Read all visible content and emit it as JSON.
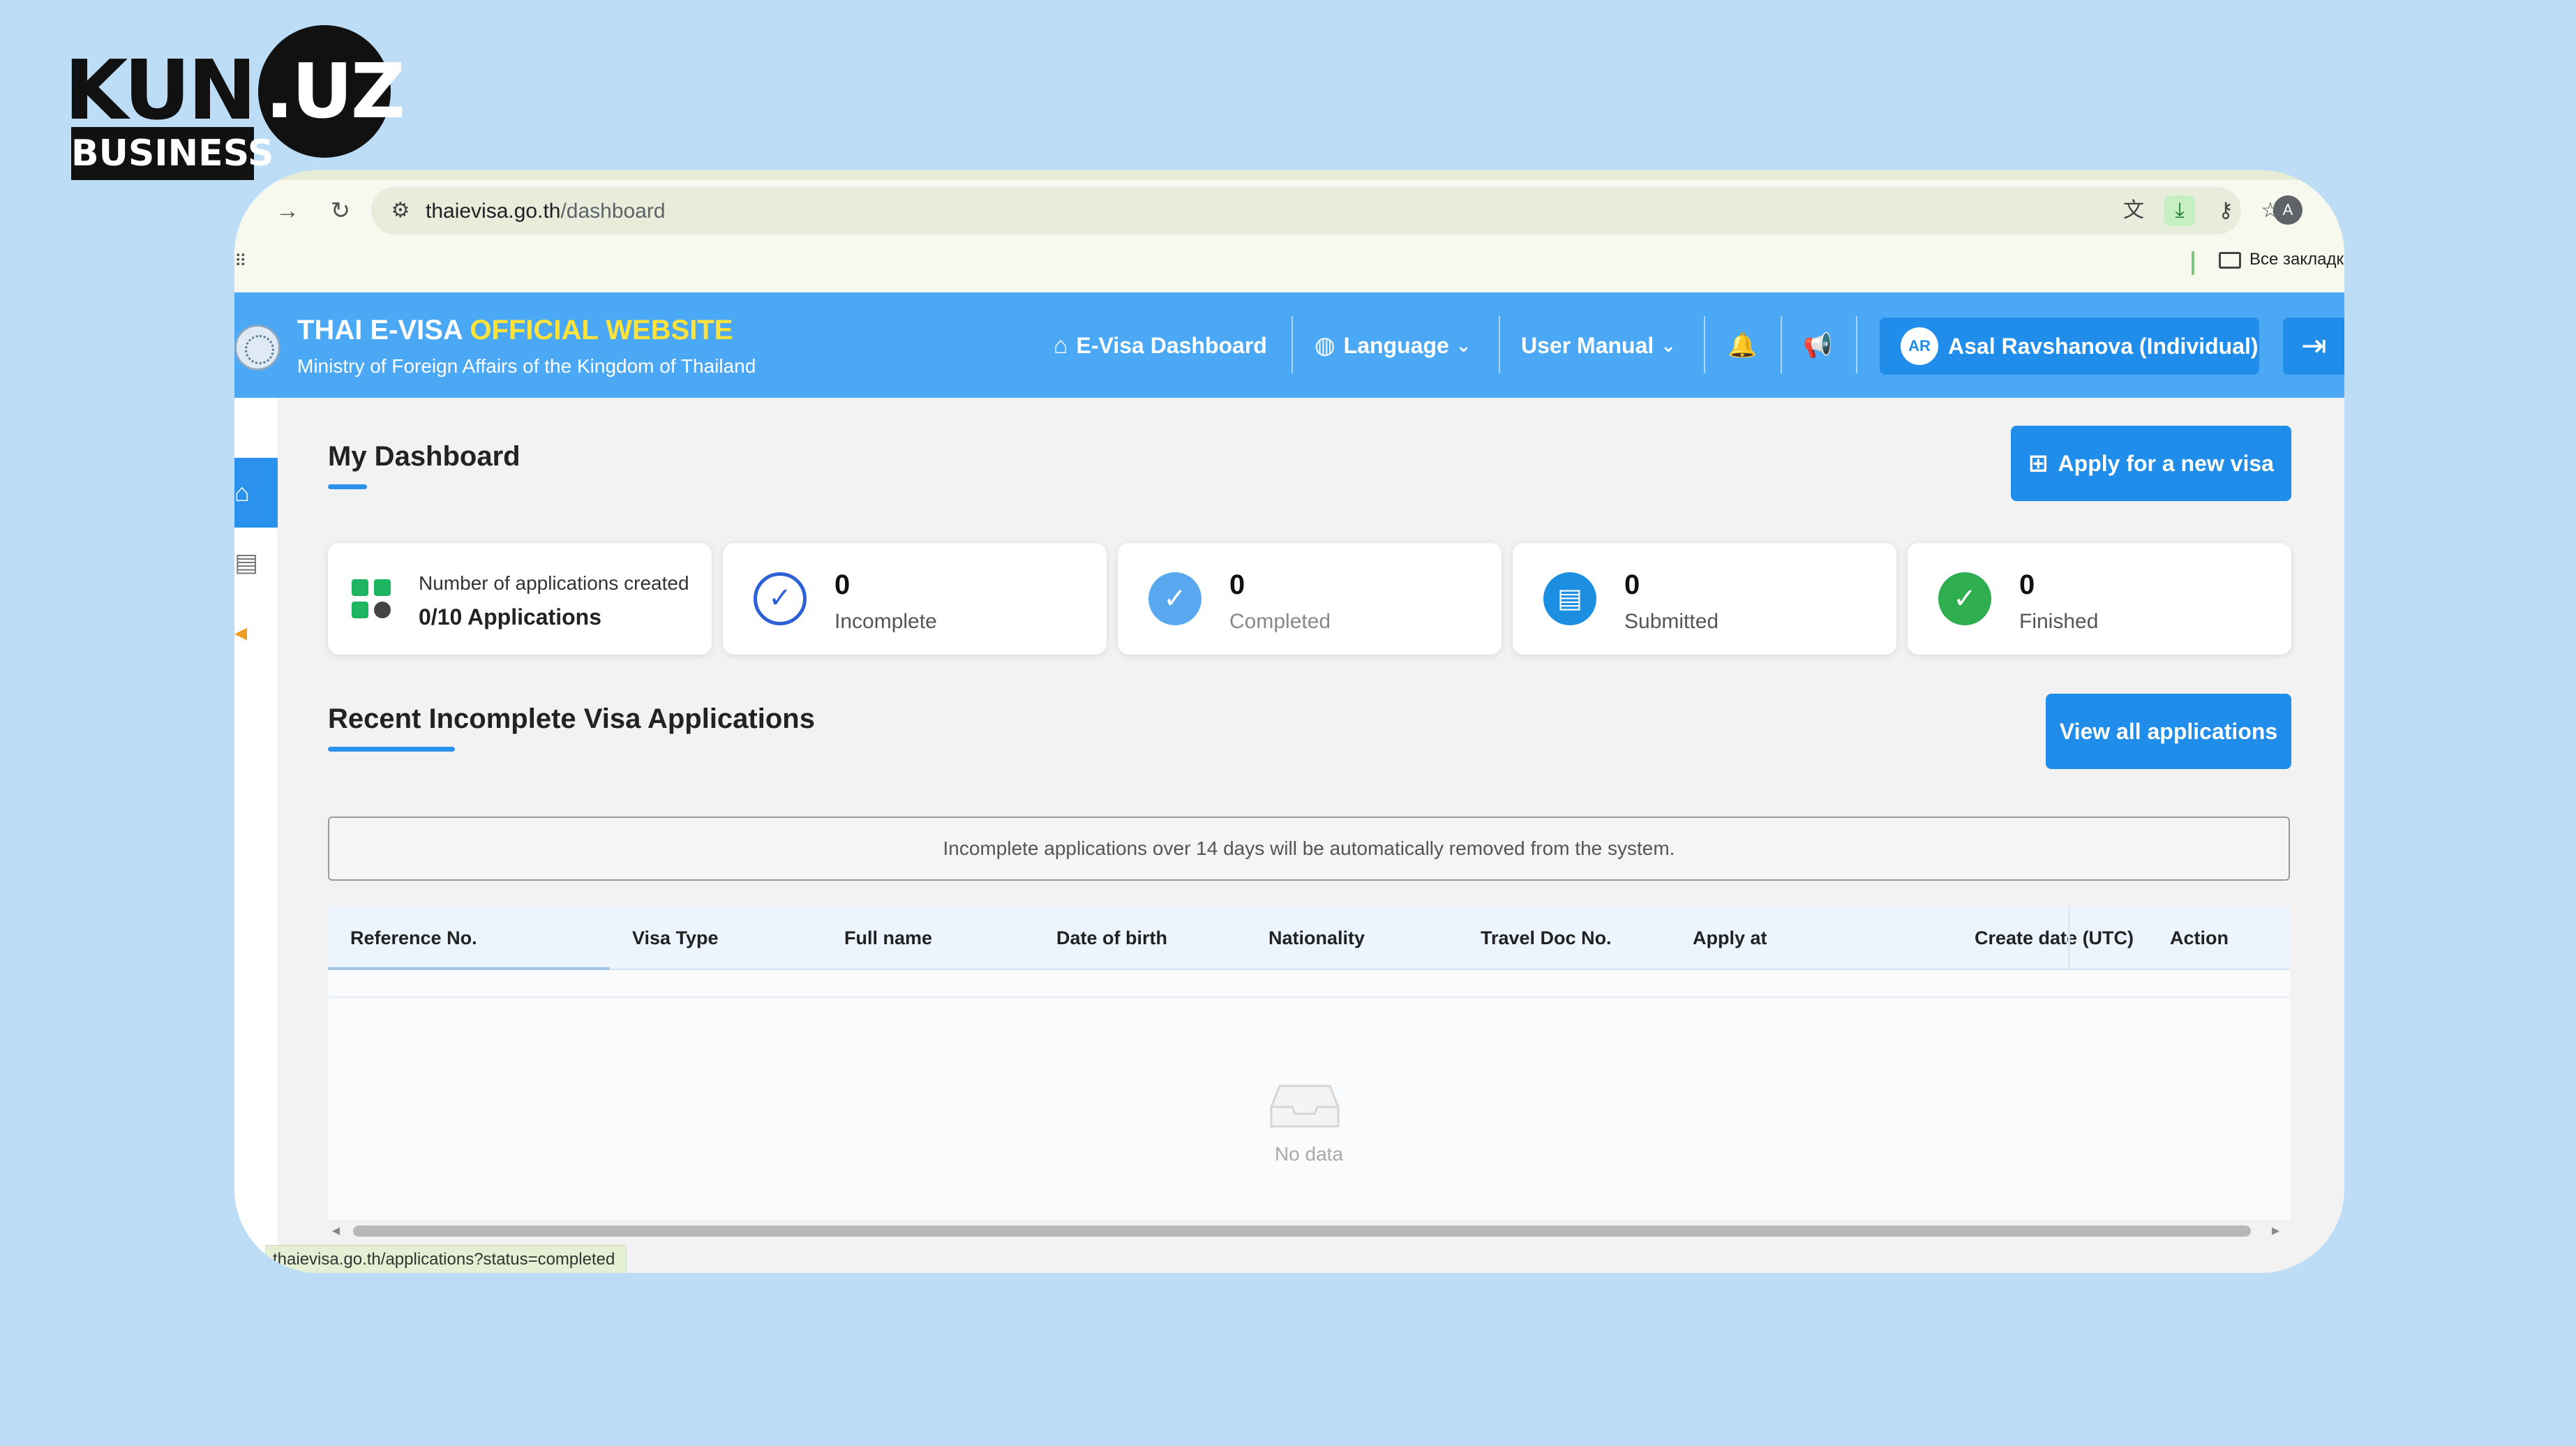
{
  "logo": {
    "kun": "KUN",
    "uz": ".UZ",
    "business": "BUSINESS"
  },
  "browser": {
    "url_host": "thaievisa.go.th",
    "url_path": "/dashboard",
    "profile_initial": "A",
    "bookmark_folder": "Все закладки",
    "status_url": "thaievisa.go.th/applications?status=completed"
  },
  "header": {
    "title_main": "THAI E-VISA ",
    "title_accent": "OFFICIAL WEBSITE",
    "subtitle": "Ministry of Foreign Affairs of the Kingdom of Thailand",
    "nav_dashboard": "E-Visa Dashboard",
    "nav_language": "Language",
    "nav_manual": "User Manual",
    "user_initials": "AR",
    "user_name": "Asal Ravshanova (Individual)"
  },
  "dashboard": {
    "title": "My Dashboard",
    "apply_button": "Apply for a new visa",
    "stats": {
      "created_label": "Number of applications created",
      "created_value": "0/10 Applications",
      "incomplete_value": "0",
      "incomplete_label": "Incomplete",
      "completed_value": "0",
      "completed_label": "Completed",
      "submitted_value": "0",
      "submitted_label": "Submitted",
      "finished_value": "0",
      "finished_label": "Finished"
    },
    "recent_title": "Recent Incomplete Visa Applications",
    "view_all_button": "View all applications",
    "notice": "Incomplete applications over 14 days will be automatically removed from the system.",
    "table": {
      "columns": [
        "Reference No.",
        "Visa Type",
        "Full name",
        "Date of birth",
        "Nationality",
        "Travel Doc No.",
        "Apply at",
        "Create date (UTC)",
        "Action"
      ],
      "empty_text": "No data"
    }
  },
  "colors": {
    "header_blue": "#4aa8f5",
    "button_blue": "#1f8de9",
    "accent_yellow": "#ffe33a",
    "success_green": "#1db561",
    "page_background": "#bdddf6"
  }
}
